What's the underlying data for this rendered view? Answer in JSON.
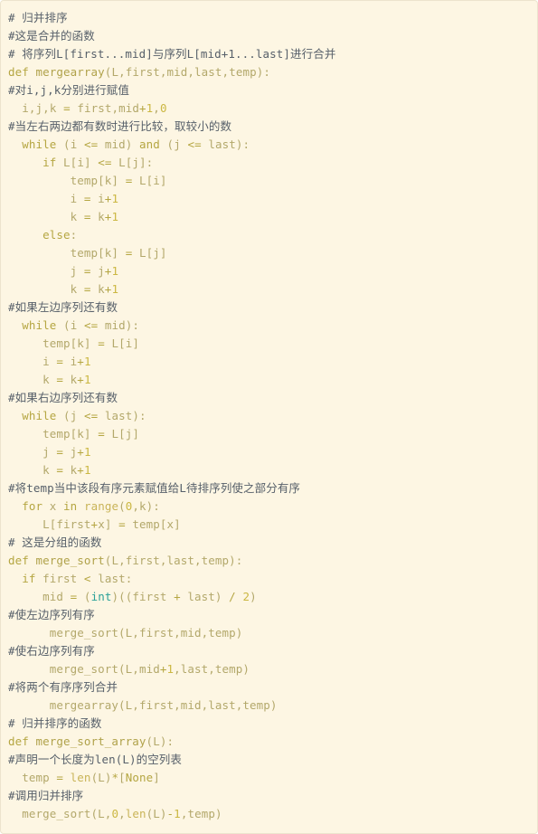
{
  "block": {
    "language": "python",
    "background_color": "#fdf6e3",
    "border_color": "#ede4cd",
    "comment_color": "#57606a",
    "code_color": "#b3a86b",
    "keyword_color": "#b5a642",
    "number_color": "#cbb742",
    "builtin_color": "#2aa198"
  },
  "code": {
    "lines": [
      "# 归并排序",
      "#这是合并的函数",
      "# 将序列L[first...mid]与序列L[mid+1...last]进行合并",
      "def mergearray(L,first,mid,last,temp):",
      "#对i,j,k分别进行赋值",
      "  i,j,k = first,mid+1,0",
      "#当左右两边都有数时进行比较，取较小的数",
      "  while (i <= mid) and (j <= last):",
      "     if L[i] <= L[j]:",
      "         temp[k] = L[i]",
      "         i = i+1",
      "         k = k+1",
      "     else:",
      "         temp[k] = L[j]",
      "         j = j+1",
      "         k = k+1",
      "#如果左边序列还有数",
      "  while (i <= mid):",
      "     temp[k] = L[i]",
      "     i = i+1",
      "     k = k+1",
      "#如果右边序列还有数",
      "  while (j <= last):",
      "     temp[k] = L[j]",
      "     j = j+1",
      "     k = k+1",
      "#将temp当中该段有序元素赋值给L待排序列使之部分有序",
      "  for x in range(0,k):",
      "     L[first+x] = temp[x]",
      "# 这是分组的函数",
      "def merge_sort(L,first,last,temp):",
      "  if first < last:",
      "     mid = (int)((first + last) / 2)",
      "#使左边序列有序",
      "      merge_sort(L,first,mid,temp)",
      "#使右边序列有序",
      "      merge_sort(L,mid+1,last,temp)",
      "#将两个有序序列合并",
      "      mergearray(L,first,mid,last,temp)",
      "# 归并排序的函数",
      "def merge_sort_array(L):",
      "#声明一个长度为len(L)的空列表",
      "  temp = len(L)*[None]",
      "#调用归并排序",
      "  merge_sort(L,0,len(L)-1,temp)"
    ]
  }
}
